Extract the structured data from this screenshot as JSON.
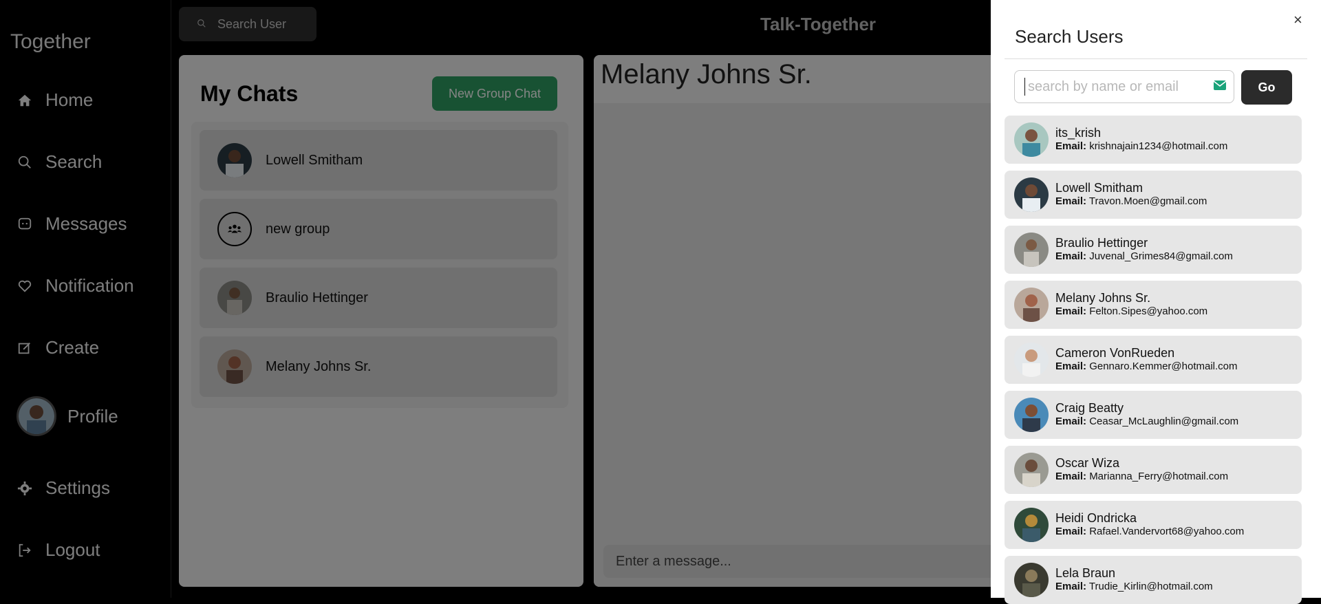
{
  "sidebar": {
    "brand": "Together",
    "items": [
      {
        "label": "Home",
        "icon": "home-icon"
      },
      {
        "label": "Search",
        "icon": "search-icon"
      },
      {
        "label": "Messages",
        "icon": "message-icon"
      },
      {
        "label": "Notification",
        "icon": "heart-icon"
      },
      {
        "label": "Create",
        "icon": "create-icon"
      },
      {
        "label": "Profile",
        "icon": "avatar"
      },
      {
        "label": "Settings",
        "icon": "gear-icon"
      },
      {
        "label": "Logout",
        "icon": "logout-icon"
      }
    ]
  },
  "topbar": {
    "search_label": "Search User",
    "app_title": "Talk-Together"
  },
  "chats": {
    "title": "My Chats",
    "new_group_label": "New Group Chat",
    "items": [
      {
        "name": "Lowell Smitham",
        "type": "user"
      },
      {
        "name": "new group",
        "type": "group"
      },
      {
        "name": "Braulio Hettinger",
        "type": "user"
      },
      {
        "name": "Melany Johns Sr.",
        "type": "user"
      }
    ]
  },
  "conversation": {
    "name": "Melany Johns Sr.",
    "input_placeholder": "Enter a message..."
  },
  "drawer": {
    "title": "Search Users",
    "close_glyph": "×",
    "search_placeholder": "search by name or email",
    "go_label": "Go",
    "email_label": "Email:",
    "users": [
      {
        "name": "its_krish",
        "email": "krishnajain1234@hotmail.com"
      },
      {
        "name": "Lowell Smitham",
        "email": "Travon.Moen@gmail.com"
      },
      {
        "name": "Braulio Hettinger",
        "email": "Juvenal_Grimes84@gmail.com"
      },
      {
        "name": "Melany Johns Sr.",
        "email": "Felton.Sipes@yahoo.com"
      },
      {
        "name": "Cameron VonRueden",
        "email": "Gennaro.Kemmer@hotmail.com"
      },
      {
        "name": "Craig Beatty",
        "email": "Ceasar_McLaughlin@gmail.com"
      },
      {
        "name": "Oscar Wiza",
        "email": "Marianna_Ferry@hotmail.com"
      },
      {
        "name": "Heidi Ondricka",
        "email": "Rafael.Vandervort68@yahoo.com"
      },
      {
        "name": "Lela Braun",
        "email": "Trudie_Kirlin@hotmail.com"
      }
    ]
  },
  "colors": {
    "accent_green": "#2f9e62",
    "go_button": "#2b2b2b"
  }
}
